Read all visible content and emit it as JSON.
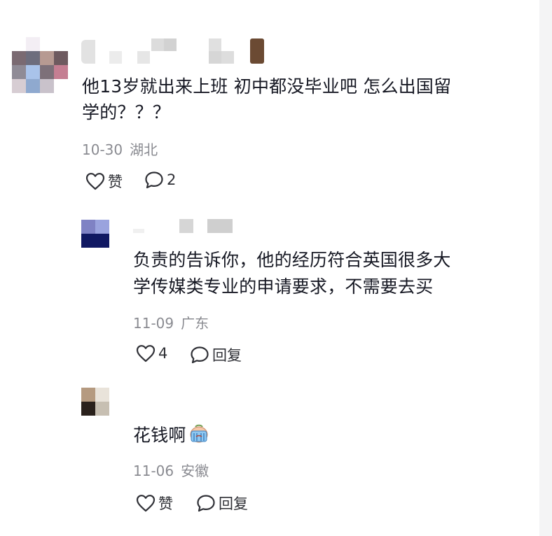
{
  "comments": [
    {
      "text_lines": [
        "他13岁就出来上班 初中都没毕业吧 怎么出国留",
        "学的？？？"
      ],
      "date": "10-30",
      "location": "湖北",
      "actions": {
        "like_label": "赞",
        "reply_count": "2"
      }
    },
    {
      "text_lines": [
        "负责的告诉你，他的经历符合英国很多大",
        "学传媒类专业的申请要求，不需要去买"
      ],
      "date": "11-09",
      "location": "广东",
      "actions": {
        "like_count": "4",
        "reply_label": "回复"
      }
    },
    {
      "text_lines": [
        "花钱啊"
      ],
      "emoji_icon": "crying-emoji-icon",
      "date": "11-06",
      "location": "安徽",
      "actions": {
        "like_label": "赞",
        "reply_label": "回复"
      }
    }
  ],
  "colors": {
    "text": "#161823",
    "meta": "#8a8b91",
    "action": "#2f3036"
  }
}
